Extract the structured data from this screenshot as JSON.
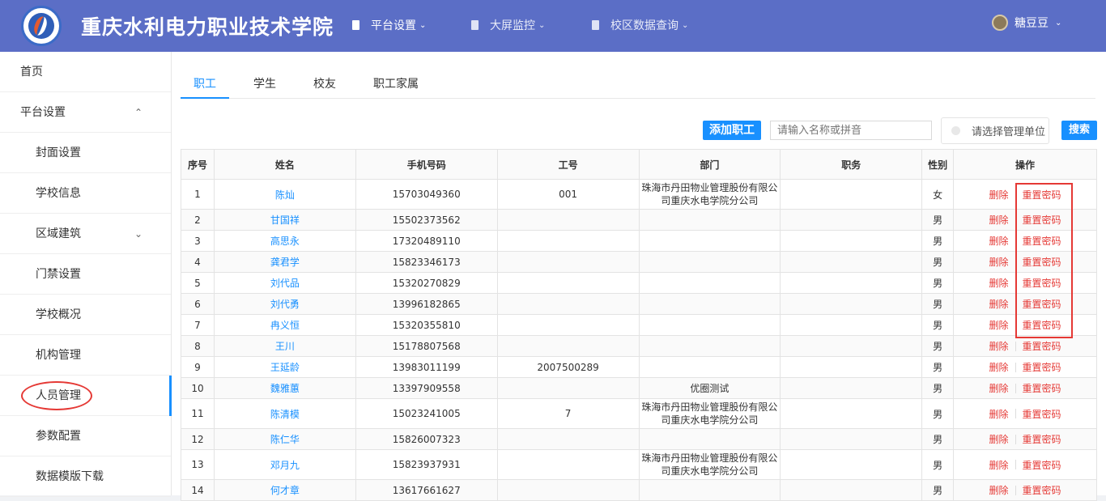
{
  "header": {
    "school_name": "重庆水利电力职业技术学院",
    "nav": [
      {
        "label": "平台设置"
      },
      {
        "label": "大屏监控"
      },
      {
        "label": "校区数据查询"
      }
    ],
    "user_name": "糖豆豆"
  },
  "sidebar": {
    "items": [
      {
        "label": "首页",
        "level": "top"
      },
      {
        "label": "平台设置",
        "level": "top",
        "arrow": "up"
      },
      {
        "label": "封面设置",
        "level": "sub"
      },
      {
        "label": "学校信息",
        "level": "sub"
      },
      {
        "label": "区域建筑",
        "level": "sub",
        "arrow": "down"
      },
      {
        "label": "门禁设置",
        "level": "sub"
      },
      {
        "label": "学校概况",
        "level": "sub"
      },
      {
        "label": "机构管理",
        "level": "sub"
      },
      {
        "label": "人员管理",
        "level": "sub",
        "active": true
      },
      {
        "label": "参数配置",
        "level": "sub"
      },
      {
        "label": "数据模版下载",
        "level": "sub"
      }
    ]
  },
  "tabs": [
    "职工",
    "学生",
    "校友",
    "职工家属"
  ],
  "toolbar": {
    "add_label": "添加职工",
    "search_placeholder": "请输入名称或拼音",
    "unit_placeholder": "请选择管理单位",
    "search_label": "搜索"
  },
  "table": {
    "headers": [
      "序号",
      "姓名",
      "手机号码",
      "工号",
      "部门",
      "职务",
      "性别",
      "操作"
    ],
    "delete_label": "删除",
    "reset_label": "重置密码",
    "rows": [
      {
        "no": "1",
        "name": "陈灿",
        "phone": "15703049360",
        "job_no": "001",
        "dept": "珠海市丹田物业管理股份有限公司重庆水电学院分公司",
        "title": "",
        "gender": "女"
      },
      {
        "no": "2",
        "name": "甘国祥",
        "phone": "15502373562",
        "job_no": "",
        "dept": "",
        "title": "",
        "gender": "男"
      },
      {
        "no": "3",
        "name": "高思永",
        "phone": "17320489110",
        "job_no": "",
        "dept": "",
        "title": "",
        "gender": "男"
      },
      {
        "no": "4",
        "name": "龚君学",
        "phone": "15823346173",
        "job_no": "",
        "dept": "",
        "title": "",
        "gender": "男"
      },
      {
        "no": "5",
        "name": "刘代品",
        "phone": "15320270829",
        "job_no": "",
        "dept": "",
        "title": "",
        "gender": "男"
      },
      {
        "no": "6",
        "name": "刘代勇",
        "phone": "13996182865",
        "job_no": "",
        "dept": "",
        "title": "",
        "gender": "男"
      },
      {
        "no": "7",
        "name": "冉义恒",
        "phone": "15320355810",
        "job_no": "",
        "dept": "",
        "title": "",
        "gender": "男"
      },
      {
        "no": "8",
        "name": "王川",
        "phone": "15178807568",
        "job_no": "",
        "dept": "",
        "title": "",
        "gender": "男"
      },
      {
        "no": "9",
        "name": "王延龄",
        "phone": "13983011199",
        "job_no": "2007500289",
        "dept": "",
        "title": "",
        "gender": "男"
      },
      {
        "no": "10",
        "name": "魏雅蕙",
        "phone": "13397909558",
        "job_no": "",
        "dept": "优圈测试",
        "title": "",
        "gender": "男"
      },
      {
        "no": "11",
        "name": "陈清模",
        "phone": "15023241005",
        "job_no": "7",
        "dept": "珠海市丹田物业管理股份有限公司重庆水电学院分公司",
        "title": "",
        "gender": "男"
      },
      {
        "no": "12",
        "name": "陈仁华",
        "phone": "15826007323",
        "job_no": "",
        "dept": "",
        "title": "",
        "gender": "男"
      },
      {
        "no": "13",
        "name": "邓月九",
        "phone": "15823937931",
        "job_no": "",
        "dept": "珠海市丹田物业管理股份有限公司重庆水电学院分公司",
        "title": "",
        "gender": "男"
      },
      {
        "no": "14",
        "name": "何才章",
        "phone": "13617661627",
        "job_no": "",
        "dept": "",
        "title": "",
        "gender": "男"
      }
    ]
  }
}
